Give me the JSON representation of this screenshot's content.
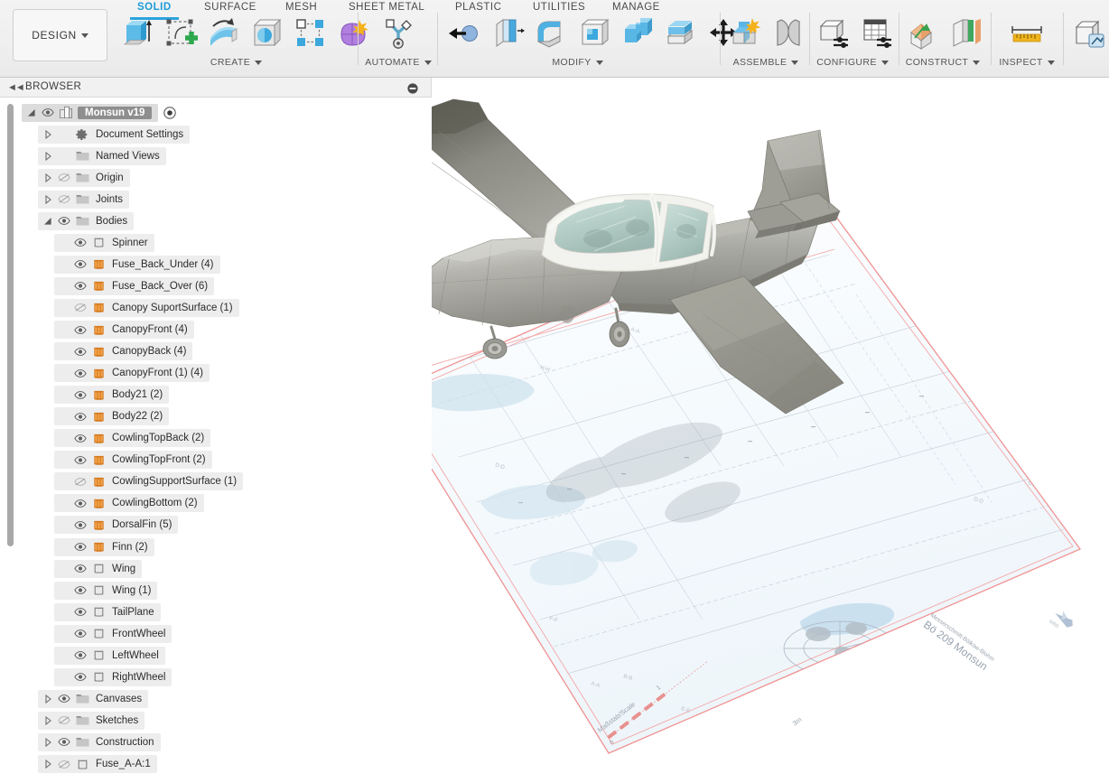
{
  "app": {
    "workspace_label": "DESIGN",
    "tabs": [
      {
        "label": "SOLID",
        "active": true
      },
      {
        "label": "SURFACE",
        "active": false
      },
      {
        "label": "MESH",
        "active": false
      },
      {
        "label": "SHEET METAL",
        "active": false
      },
      {
        "label": "PLASTIC",
        "active": false
      },
      {
        "label": "UTILITIES",
        "active": false
      },
      {
        "label": "MANAGE",
        "active": false
      }
    ],
    "ribbon_groups": [
      {
        "title": "CREATE",
        "icons": [
          "extrude-icon",
          "create-sketch-icon",
          "revolve-icon",
          "hole-icon",
          "rectangular-pattern-icon",
          "create-form-icon"
        ]
      },
      {
        "title": "AUTOMATE",
        "icons": [
          "automate-icon"
        ]
      },
      {
        "title": "MODIFY",
        "icons": [
          "press-pull-icon",
          "offset-face-icon",
          "fillet-icon",
          "shell-icon",
          "combine-icon",
          "split-face-icon",
          "move-copy-icon"
        ]
      },
      {
        "title": "ASSEMBLE",
        "icons": [
          "new-component-icon",
          "joint-icon"
        ]
      },
      {
        "title": "CONFIGURE",
        "icons": [
          "configuration-icon",
          "configuration-table-icon"
        ]
      },
      {
        "title": "CONSTRUCT",
        "icons": [
          "offset-plane-icon",
          "plane-through-points-icon"
        ]
      },
      {
        "title": "INSPECT",
        "icons": [
          "measure-icon"
        ]
      },
      {
        "title": "",
        "icons": [
          "section-analysis-icon"
        ]
      }
    ]
  },
  "browser": {
    "title": "BROWSER",
    "collapse_icon": "collapse-arrows-icon",
    "minimize_icon": "minimize-icon",
    "tree": [
      {
        "label": "Monsun v19",
        "indent": 0,
        "twisty": "expanded",
        "eye": "visible",
        "icon": "component-icon",
        "root": true,
        "radio": true
      },
      {
        "label": "Document Settings",
        "indent": 1,
        "twisty": "collapsed",
        "eye": "none",
        "icon": "gear-icon"
      },
      {
        "label": "Named Views",
        "indent": 1,
        "twisty": "collapsed",
        "eye": "none",
        "icon": "folder-icon"
      },
      {
        "label": "Origin",
        "indent": 1,
        "twisty": "collapsed",
        "eye": "hidden",
        "icon": "folder-icon"
      },
      {
        "label": "Joints",
        "indent": 1,
        "twisty": "collapsed",
        "eye": "hidden",
        "icon": "folder-icon"
      },
      {
        "label": "Bodies",
        "indent": 1,
        "twisty": "expanded",
        "eye": "visible",
        "icon": "folder-icon"
      },
      {
        "label": "Spinner",
        "indent": 2,
        "twisty": "none",
        "eye": "visible",
        "icon": "body-grey-icon"
      },
      {
        "label": "Fuse_Back_Under (4)",
        "indent": 2,
        "twisty": "none",
        "eye": "visible",
        "icon": "body-orange-icon"
      },
      {
        "label": "Fuse_Back_Over (6)",
        "indent": 2,
        "twisty": "none",
        "eye": "visible",
        "icon": "body-orange-icon"
      },
      {
        "label": "Canopy SuportSurface (1)",
        "indent": 2,
        "twisty": "none",
        "eye": "hidden",
        "icon": "body-orange-icon"
      },
      {
        "label": "CanopyFront (4)",
        "indent": 2,
        "twisty": "none",
        "eye": "visible",
        "icon": "body-orange-icon"
      },
      {
        "label": "CanopyBack (4)",
        "indent": 2,
        "twisty": "none",
        "eye": "visible",
        "icon": "body-orange-icon"
      },
      {
        "label": "CanopyFront (1) (4)",
        "indent": 2,
        "twisty": "none",
        "eye": "visible",
        "icon": "body-orange-icon"
      },
      {
        "label": "Body21 (2)",
        "indent": 2,
        "twisty": "none",
        "eye": "visible",
        "icon": "body-orange-icon"
      },
      {
        "label": "Body22 (2)",
        "indent": 2,
        "twisty": "none",
        "eye": "visible",
        "icon": "body-orange-icon"
      },
      {
        "label": "CowlingTopBack (2)",
        "indent": 2,
        "twisty": "none",
        "eye": "visible",
        "icon": "body-orange-icon"
      },
      {
        "label": "CowlingTopFront (2)",
        "indent": 2,
        "twisty": "none",
        "eye": "visible",
        "icon": "body-orange-icon"
      },
      {
        "label": "CowlingSupportSurface (1)",
        "indent": 2,
        "twisty": "none",
        "eye": "hidden",
        "icon": "body-orange-icon"
      },
      {
        "label": "CowlingBottom (2)",
        "indent": 2,
        "twisty": "none",
        "eye": "visible",
        "icon": "body-orange-icon"
      },
      {
        "label": "DorsalFin (5)",
        "indent": 2,
        "twisty": "none",
        "eye": "visible",
        "icon": "body-orange-icon"
      },
      {
        "label": "Finn (2)",
        "indent": 2,
        "twisty": "none",
        "eye": "visible",
        "icon": "body-orange-icon"
      },
      {
        "label": "Wing",
        "indent": 2,
        "twisty": "none",
        "eye": "visible",
        "icon": "body-grey-icon"
      },
      {
        "label": "Wing (1)",
        "indent": 2,
        "twisty": "none",
        "eye": "visible",
        "icon": "body-grey-icon"
      },
      {
        "label": "TailPlane",
        "indent": 2,
        "twisty": "none",
        "eye": "visible",
        "icon": "body-grey-icon"
      },
      {
        "label": "FrontWheel",
        "indent": 2,
        "twisty": "none",
        "eye": "visible",
        "icon": "body-grey-icon"
      },
      {
        "label": "LeftWheel",
        "indent": 2,
        "twisty": "none",
        "eye": "visible",
        "icon": "body-grey-icon"
      },
      {
        "label": "RightWheel",
        "indent": 2,
        "twisty": "none",
        "eye": "visible",
        "icon": "body-grey-icon"
      },
      {
        "label": "Canvases",
        "indent": 1,
        "twisty": "collapsed",
        "eye": "visible",
        "icon": "folder-icon"
      },
      {
        "label": "Sketches",
        "indent": 1,
        "twisty": "collapsed",
        "eye": "hidden",
        "icon": "folder-icon"
      },
      {
        "label": "Construction",
        "indent": 1,
        "twisty": "collapsed",
        "eye": "visible",
        "icon": "folder-icon"
      },
      {
        "label": "Fuse_A-A:1",
        "indent": 1,
        "twisty": "collapsed",
        "eye": "hidden",
        "icon": "body-grey-icon"
      }
    ]
  },
  "viewport": {
    "model_name": "Bo 209 Monsun aircraft model",
    "canvas_labels": {
      "title_line1": "Messerschmitt-Bölkow-Blohm",
      "title_line2": "Bö 209 Monsun",
      "scale_label": "Maßstab/Scale",
      "scale_start": "0",
      "scale_mid": "1",
      "scale_end": "3m"
    }
  },
  "colors": {
    "accent_blue": "#2ba3dd",
    "body_orange": "#e8852a",
    "canvas_plane_edge": "#f08a8a",
    "model_grey": "#9b9b96",
    "canopy_glass": "#b9cfc9"
  }
}
